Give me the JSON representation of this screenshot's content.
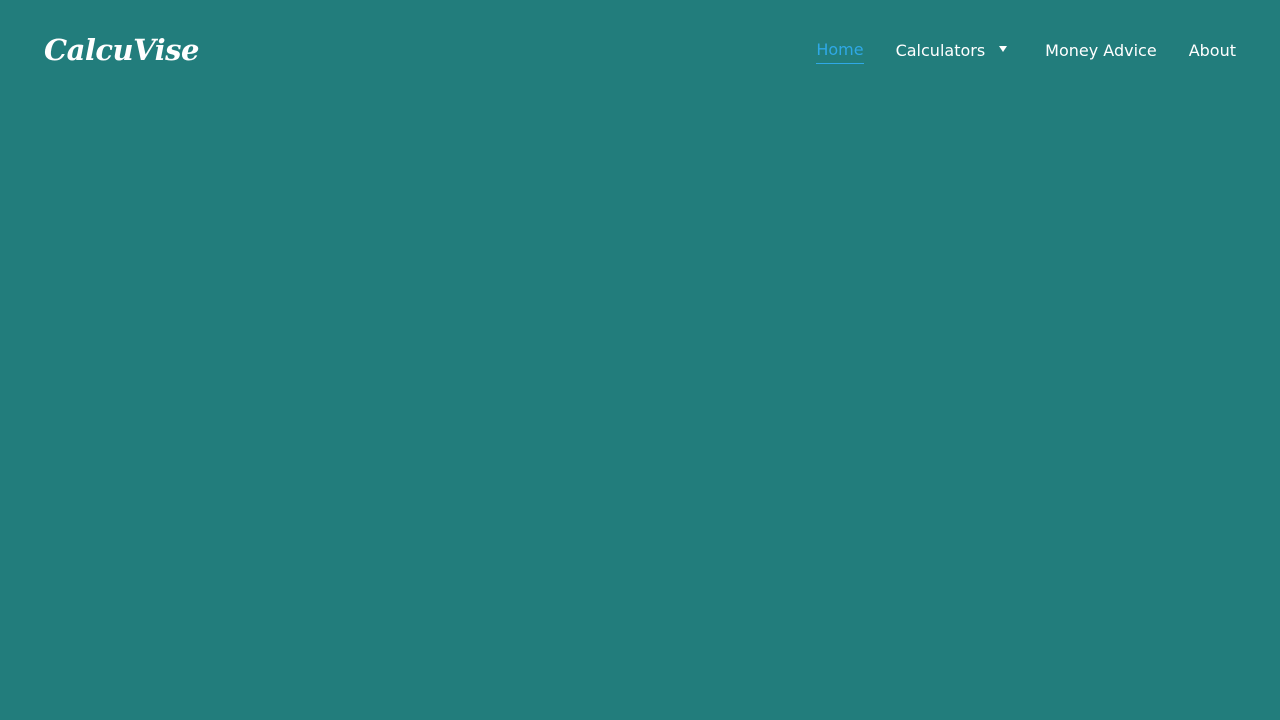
{
  "brand": {
    "name": "CalcuVise"
  },
  "nav": {
    "items": [
      {
        "label": "Home",
        "active": true
      },
      {
        "label": "Calculators",
        "has_dropdown": true
      },
      {
        "label": "Money Advice"
      },
      {
        "label": "About"
      }
    ]
  },
  "colors": {
    "background": "#227d7c",
    "text": "#ffffff",
    "active_link": "#2fa8e6"
  },
  "icons": {
    "dropdown": "caret-down-icon"
  }
}
